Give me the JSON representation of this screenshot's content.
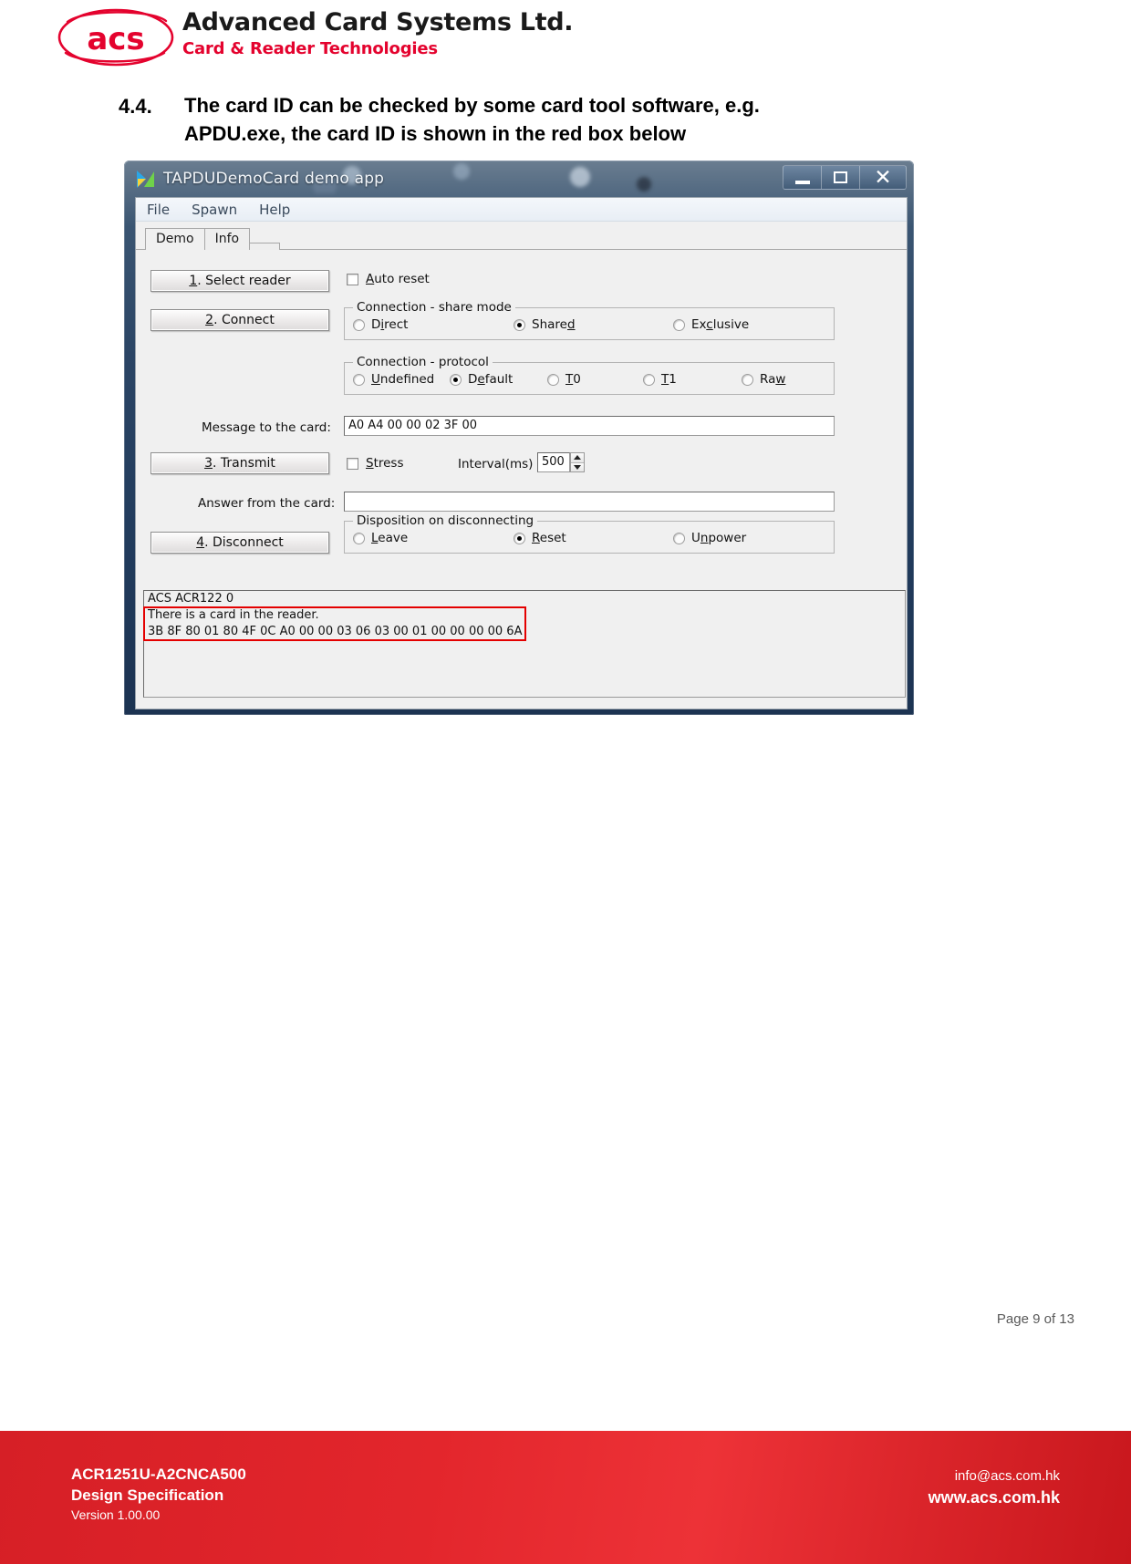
{
  "brand": {
    "logo_mark": "acs-logo",
    "company": "Advanced Card Systems Ltd.",
    "tagline": "Card & Reader Technologies",
    "accent_color": "#e4032e"
  },
  "section": {
    "number": "4.4.",
    "title_line1": "The card ID can be checked by some card tool software, e.g.",
    "title_line2": "APDU.exe, the card ID is shown in the red box below"
  },
  "app_window": {
    "title": "TAPDUDemoCard demo app",
    "window_buttons": {
      "minimize": "minimize-icon",
      "maximize": "maximize-icon",
      "close": "close-icon"
    },
    "menu": [
      "File",
      "Spawn",
      "Help"
    ],
    "tabs": [
      {
        "label": "Demo",
        "active": true
      },
      {
        "label": "Info",
        "active": false
      }
    ],
    "buttons": {
      "select_reader": {
        "prefix": "1",
        "rest": ". Select reader"
      },
      "connect": {
        "prefix": "2",
        "rest": ". Connect"
      },
      "transmit": {
        "prefix": "3",
        "rest": ". Transmit"
      },
      "disconnect": {
        "prefix": "4",
        "rest": ". Disconnect"
      }
    },
    "auto_reset": {
      "label_accel": "A",
      "label_rest": "uto reset",
      "checked": false
    },
    "share_mode": {
      "title": "Connection - share mode",
      "options": [
        {
          "pre": "D",
          "accel": "i",
          "post": "rect",
          "selected": false
        },
        {
          "pre": "Share",
          "accel": "d",
          "post": "",
          "selected": true
        },
        {
          "pre": "Ex",
          "accel": "c",
          "post": "lusive",
          "selected": false
        }
      ]
    },
    "protocol": {
      "title": "Connection - protocol",
      "options": [
        {
          "pre": "",
          "accel": "U",
          "post": "ndefined",
          "selected": false
        },
        {
          "pre": "D",
          "accel": "e",
          "post": "fault",
          "selected": true
        },
        {
          "pre": "",
          "accel": "T",
          "post": "0",
          "selected": false
        },
        {
          "pre": "",
          "accel": "T",
          "post": "1",
          "selected": false
        },
        {
          "pre": "Ra",
          "accel": "w",
          "post": "",
          "selected": false
        }
      ]
    },
    "message_to_card": {
      "label": "Message to the card:",
      "value": "A0 A4 00 00 02 3F 00"
    },
    "stress": {
      "label_accel": "S",
      "label_rest": "tress",
      "checked": false
    },
    "interval": {
      "label": "Interval(ms)",
      "value": "500"
    },
    "answer_from_card": {
      "label": "Answer from the card:",
      "value": ""
    },
    "disposition": {
      "title": "Disposition on disconnecting",
      "options": [
        {
          "pre": "",
          "accel": "L",
          "post": "eave",
          "selected": false
        },
        {
          "pre": "",
          "accel": "R",
          "post": "eset",
          "selected": true
        },
        {
          "pre": "U",
          "accel": "n",
          "post": "power",
          "selected": false
        }
      ]
    },
    "log": {
      "lines": [
        "ACS ACR122 0",
        "There is a card in the reader.",
        "3B 8F 80 01 80 4F 0C A0 00 00 03 06 03 00 01 00 00 00 00 6A"
      ],
      "highlight_color": "#e40000",
      "highlight_lines": [
        1,
        2
      ]
    }
  },
  "footer": {
    "page_indicator": "Page 9 of 13",
    "product": "ACR1251U-A2CNCA500",
    "doc_type": "Design Specification",
    "version": "Version 1.00.00",
    "email": "info@acs.com.hk",
    "website": "www.acs.com.hk",
    "bar_color": "#e3262c"
  }
}
